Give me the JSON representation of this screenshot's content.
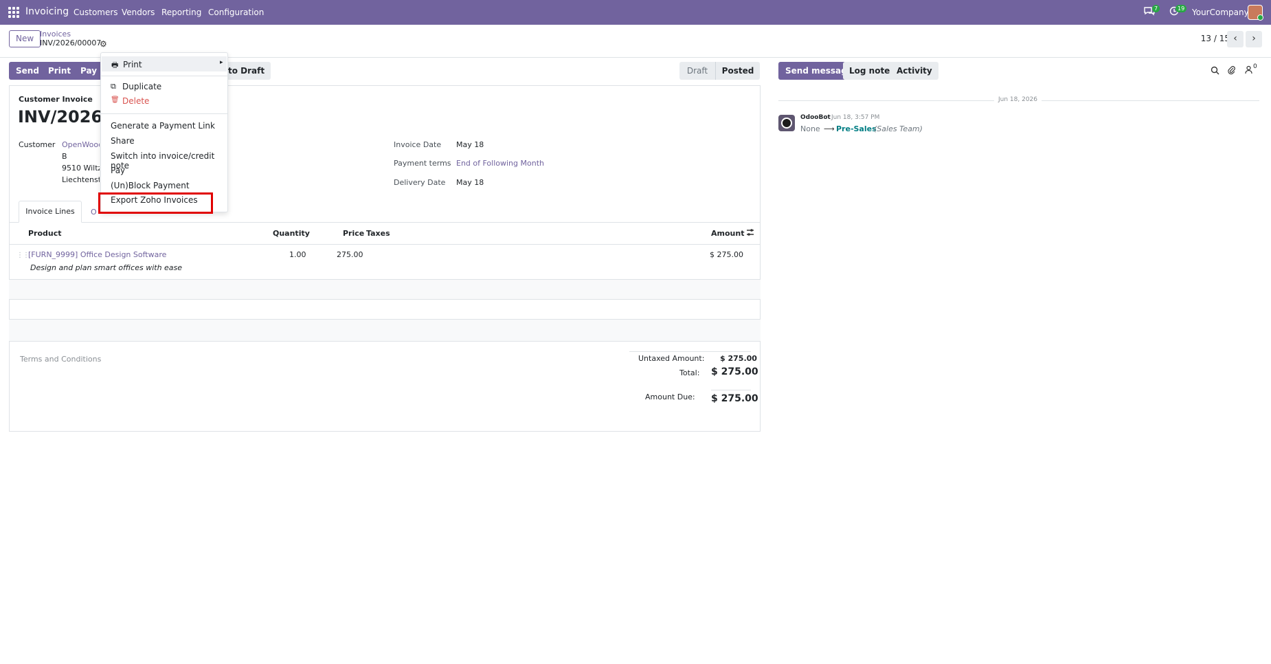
{
  "navbar": {
    "app_name": "Invoicing",
    "menus": [
      "Customers",
      "Vendors",
      "Reporting",
      "Configuration"
    ],
    "messages_badge": "7",
    "activities_badge": "19",
    "company": "YourCompany"
  },
  "control_panel": {
    "new_label": "New",
    "breadcrumb_parent": "Invoices",
    "breadcrumb_current": "INV/2026/00007",
    "pager": "13 / 15"
  },
  "actions": {
    "send": "Send",
    "print": "Print",
    "pay": "Pay",
    "reset_to_draft": "to Draft"
  },
  "statusbar": {
    "draft": "Draft",
    "posted": "Posted"
  },
  "invoice": {
    "type_label": "Customer Invoice",
    "number": "INV/2026/0",
    "customer_label": "Customer",
    "customer_name": "OpenWooc",
    "address_line1": "B",
    "address_line2": "9510 Wiltz",
    "address_line3": "Liechtenst",
    "invoice_date_label": "Invoice Date",
    "invoice_date": "May 18",
    "payment_terms_label": "Payment terms",
    "payment_terms": "End of Following Month",
    "delivery_date_label": "Delivery Date",
    "delivery_date": "May 18"
  },
  "tabs": {
    "invoice_lines": "Invoice Lines",
    "other": "O"
  },
  "lines_table": {
    "headers": {
      "product": "Product",
      "quantity": "Quantity",
      "price": "Price",
      "taxes": "Taxes",
      "amount": "Amount"
    },
    "rows": [
      {
        "product": "[FURN_9999] Office Design Software",
        "description": "Design and plan smart offices with ease",
        "quantity": "1.00",
        "price": "275.00",
        "amount": "$ 275.00"
      }
    ]
  },
  "totals": {
    "terms_placeholder": "Terms and Conditions",
    "untaxed_label": "Untaxed Amount:",
    "untaxed_value": "$ 275.00",
    "total_label": "Total:",
    "total_value": "$ 275.00",
    "amount_due_label": "Amount Due:",
    "amount_due_value": "$ 275.00"
  },
  "dropdown": {
    "print": "Print",
    "duplicate": "Duplicate",
    "delete": "Delete",
    "payment_link": "Generate a Payment Link",
    "share": "Share",
    "switch": "Switch into invoice/credit note",
    "pay": "Pay",
    "block_payment": "(Un)Block Payment",
    "export_zoho": "Export Zoho Invoices"
  },
  "chatter": {
    "send_message": "Send message",
    "log_note": "Log note",
    "activity": "Activity",
    "followers_count": "0",
    "date_separator": "Jun 18, 2026",
    "message": {
      "author": "OdooBot",
      "time": "Jun 18, 3:57 PM",
      "old_value": "None",
      "arrow": "⟶",
      "new_value": "Pre-Sales",
      "field": "(Sales Team)"
    }
  },
  "colors": {
    "brand": "#71639e",
    "highlight": "#e00000",
    "danger": "#d9534f",
    "link": "#017e84"
  }
}
